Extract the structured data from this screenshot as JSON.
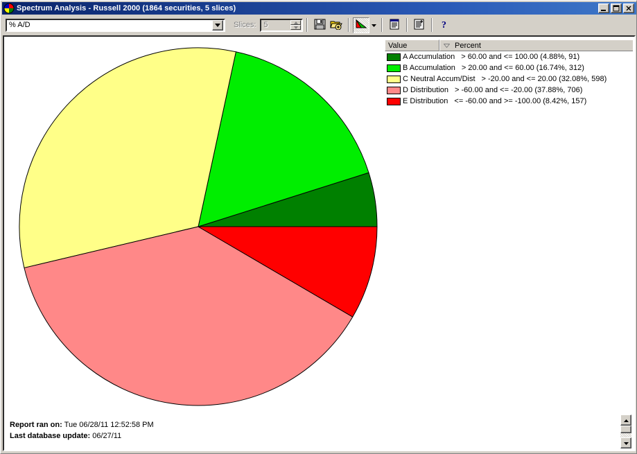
{
  "window": {
    "title": "Spectrum Analysis - Russell 2000 (1864 securities, 5 slices)",
    "app_icon": "pie-chart-icon",
    "minimize_label": "Minimize",
    "maximize_label": "Maximize",
    "close_label": "Close"
  },
  "toolbar": {
    "dataset_value": "% A/D",
    "dataset_placeholder": "% A/D",
    "dropdown_icon": "chevron-down-icon",
    "slices_label": "Slices:",
    "slices_value": "5",
    "buttons": [
      {
        "name": "save-button",
        "icon": "floppy-disk-icon",
        "label": "Save"
      },
      {
        "name": "open-button",
        "icon": "open-folder-icon",
        "label": "Open"
      },
      {
        "name": "chart-type-button",
        "icon": "pie-chart-icon",
        "label": "Chart Type"
      },
      {
        "name": "chart-type-dropdown",
        "icon": "chevron-down-icon",
        "label": "Chart Type Options"
      },
      {
        "name": "report-view-button",
        "icon": "list-report-icon",
        "label": "Report View"
      },
      {
        "name": "add-report-button",
        "icon": "list-add-icon",
        "label": "Add Report"
      },
      {
        "name": "help-button",
        "icon": "question-mark-icon",
        "label": "Help"
      }
    ]
  },
  "legend": {
    "columns": [
      {
        "label": "Value",
        "sort_icon": ""
      },
      {
        "label": "Percent",
        "sort_icon": "sort-descending-icon"
      }
    ],
    "rows": [
      {
        "label": "A Accumulation",
        "range": "> 60.00 and <= 100.00 (4.88%, 91)",
        "color": "#008000"
      },
      {
        "label": "B Accumulation",
        "range": "> 20.00 and <= 60.00 (16.74%, 312)",
        "color": "#00ee00"
      },
      {
        "label": "C Neutral Accum/Dist",
        "range": "> -20.00 and <= 20.00 (32.08%, 598)",
        "color": "#ffff88"
      },
      {
        "label": "D Distribution",
        "range": "> -60.00 and <= -20.00 (37.88%, 706)",
        "color": "#ff8888"
      },
      {
        "label": "E Distribution",
        "range": "<= -60.00 and >= -100.00 (8.42%, 157)",
        "color": "#ff0000"
      }
    ]
  },
  "footer": {
    "report_ran_label": "Report ran on:",
    "report_ran_value": "Tue 06/28/11 12:52:58 PM",
    "db_update_label": "Last database update:",
    "db_update_value": "06/27/11"
  },
  "scrollbar": {
    "up_icon": "arrow-up-icon",
    "down_icon": "arrow-down-icon"
  },
  "chart_data": {
    "type": "pie",
    "title": "Spectrum Analysis - Russell 2000",
    "total_securities": 1864,
    "slice_count": 5,
    "start_angle_deg": 0,
    "direction": "counterclockwise",
    "center": [
      278,
      324
    ],
    "radius": 258,
    "categories": [
      "A Accumulation",
      "B Accumulation",
      "C Neutral Accum/Dist",
      "D Distribution",
      "E Distribution"
    ],
    "values": [
      4.88,
      16.74,
      32.08,
      37.88,
      8.42
    ],
    "counts": [
      91,
      312,
      598,
      706,
      157
    ],
    "colors": [
      "#008000",
      "#00ee00",
      "#ffff88",
      "#ff8888",
      "#ff0000"
    ],
    "ranges": [
      "> 60.00 and <= 100.00",
      "> 20.00 and <= 60.00",
      "> -20.00 and <= 20.00",
      "> -60.00 and <= -20.00",
      "<= -60.00 and >= -100.00"
    ],
    "ylabel": "Percent",
    "xlabel": "Value",
    "legend_position": "right",
    "grid": false
  }
}
